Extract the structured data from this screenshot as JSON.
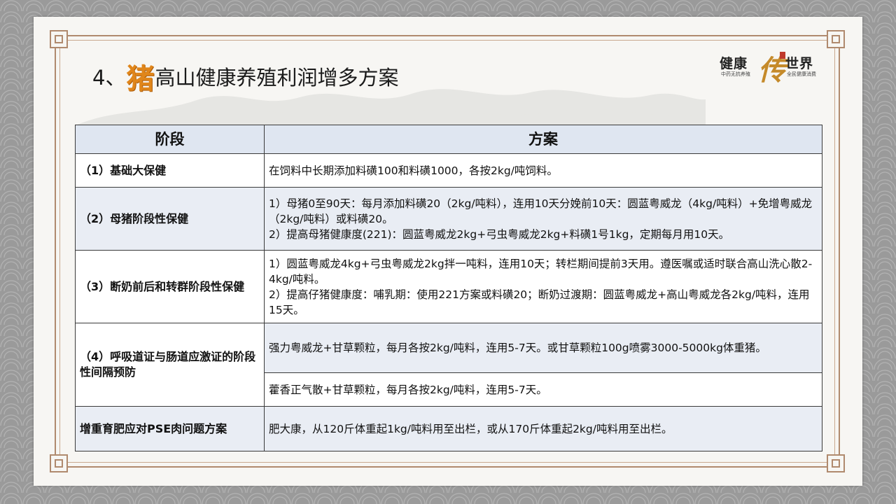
{
  "title": {
    "prefix": "4、",
    "highlight": "猪",
    "rest": "高山健康养殖利润增多方案"
  },
  "logo": {
    "left": "健康",
    "middle": "传",
    "right": "世界",
    "sub_left": "中药无抗养殖",
    "sub_right": "全民健康消费"
  },
  "table": {
    "headers": [
      "阶段",
      "方案"
    ],
    "rows": [
      {
        "stage": "（1）基础大保健",
        "plans": [
          "在饲料中长期添加料磺100和料磺1000，各按2kg/吨饲料。"
        ]
      },
      {
        "stage": "（2）母猪阶段性保健",
        "plans": [
          "1）母猪0至90天：每月添加料磺20（2kg/吨料），连用10天分娩前10天：圆蓝粤威龙（4kg/吨料）+免增粤威龙（2kg/吨料）或料磺20。\n2）提高母猪健康度(221)：圆蓝粤威龙2kg+弓虫粤威龙2kg+料磺1号1kg，定期每月用10天。"
        ]
      },
      {
        "stage": "（3）断奶前后和转群阶段性保健",
        "plans": [
          "1）圆蓝粤威龙4kg+弓虫粤威龙2kg拌一吨料，连用10天；转栏期间提前3天用。遵医嘱或适时联合高山洗心散2-4kg/吨料。\n2）提高仔猪健康度：哺乳期：使用221方案或料磺20；断奶过渡期：圆蓝粤威龙+高山粤威龙各2kg/吨料，连用15天。"
        ]
      },
      {
        "stage": "（4）呼吸道证与肠道应激证的阶段性间隔预防",
        "plans": [
          "强力粤威龙+甘草颗粒，每月各按2kg/吨料，连用5-7天。或甘草颗粒100g喷雾3000-5000kg体重猪。",
          "藿香正气散+甘草颗粒，每月各按2kg/吨料，连用5-7天。"
        ]
      },
      {
        "stage": "增重育肥应对PSE肉问题方案",
        "plans": [
          "肥大康，从120斤体重起1kg/吨料用至出栏，或从170斤体重起2kg/吨料用至出栏。"
        ]
      }
    ]
  },
  "colors": {
    "header_bg": "#dfe6f1",
    "row_blue": "#e9edf4",
    "row_white": "#ffffff",
    "highlight": "#e0861b",
    "frame": "#b08a6e"
  }
}
